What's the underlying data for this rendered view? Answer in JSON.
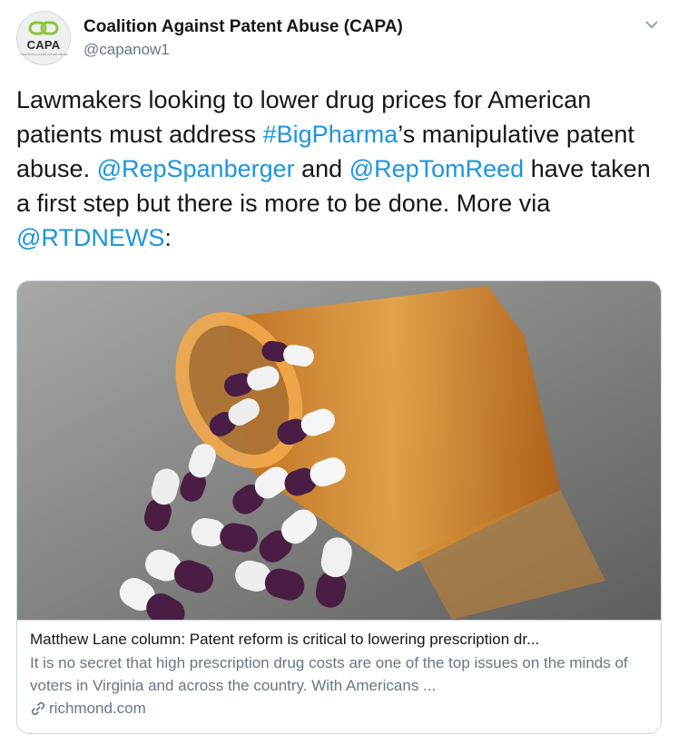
{
  "author": {
    "name": "Coalition Against Patent Abuse (CAPA)",
    "handle": "@capanow1",
    "avatar_text": "CAPA",
    "avatar_tagline": "COALITION AGAINST PATENT ABUSE"
  },
  "tweet": {
    "t1": "Lawmakers looking to lower drug prices for American patients must address ",
    "hashtag": "#BigPharma",
    "t2": "’s manipulative patent abuse. ",
    "mention1": "@RepSpanberger",
    "t3": " and ",
    "mention2": "@RepTomReed",
    "t4": " have taken a first step but there is more to be done. More via ",
    "mention3": "@RTDNEWS",
    "t5": ":"
  },
  "card": {
    "title": "Matthew Lane column: Patent reform is critical to lowering prescription dr...",
    "description": "It is no secret that high prescription drug costs are one of the top issues on the minds of voters in Virginia and across the country. With Americans ...",
    "domain": "richmond.com"
  },
  "colors": {
    "link": "#1b95e0",
    "text": "#14171a",
    "secondary": "#657786",
    "border": "#ccd6dd",
    "capsule_purple": "#4a1d44",
    "bottle_orange": "#e08a1e"
  },
  "icons": {
    "menu": "chevron-down-icon",
    "link": "link-icon",
    "avatar_logo": "capa-chain-logo"
  }
}
